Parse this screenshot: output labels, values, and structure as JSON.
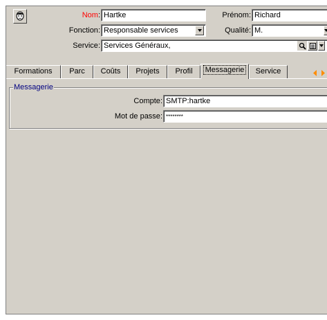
{
  "header": {
    "nom_label": "Nom",
    "nom_value": "Hartke",
    "prenom_label": "Prénom",
    "prenom_value": "Richard",
    "fonction_label": "Fonction",
    "fonction_value": "Responsable services",
    "qualite_label": "Qualité",
    "qualite_value": "M.",
    "service_label": "Service",
    "service_value": "Services Généraux,",
    "colon": ":"
  },
  "tabs": [
    {
      "label": "Formations"
    },
    {
      "label": "Parc"
    },
    {
      "label": "Coûts"
    },
    {
      "label": "Projets"
    },
    {
      "label": "Profil"
    },
    {
      "label": "Messagerie"
    },
    {
      "label": "Service"
    }
  ],
  "messagerie": {
    "group_title": "Messagerie",
    "compte_label": "Compte",
    "compte_value": "SMTP:hartke",
    "password_label": "Mot de passe",
    "password_value": "********"
  },
  "colors": {
    "required": "#ff0000",
    "group_title": "#000080",
    "panel": "#d4d0c8"
  },
  "icons": [
    "user-portrait-icon",
    "search-icon",
    "detail-icon",
    "dropdown-arrow-icon",
    "tab-scroll-left-icon",
    "tab-scroll-right-icon"
  ]
}
